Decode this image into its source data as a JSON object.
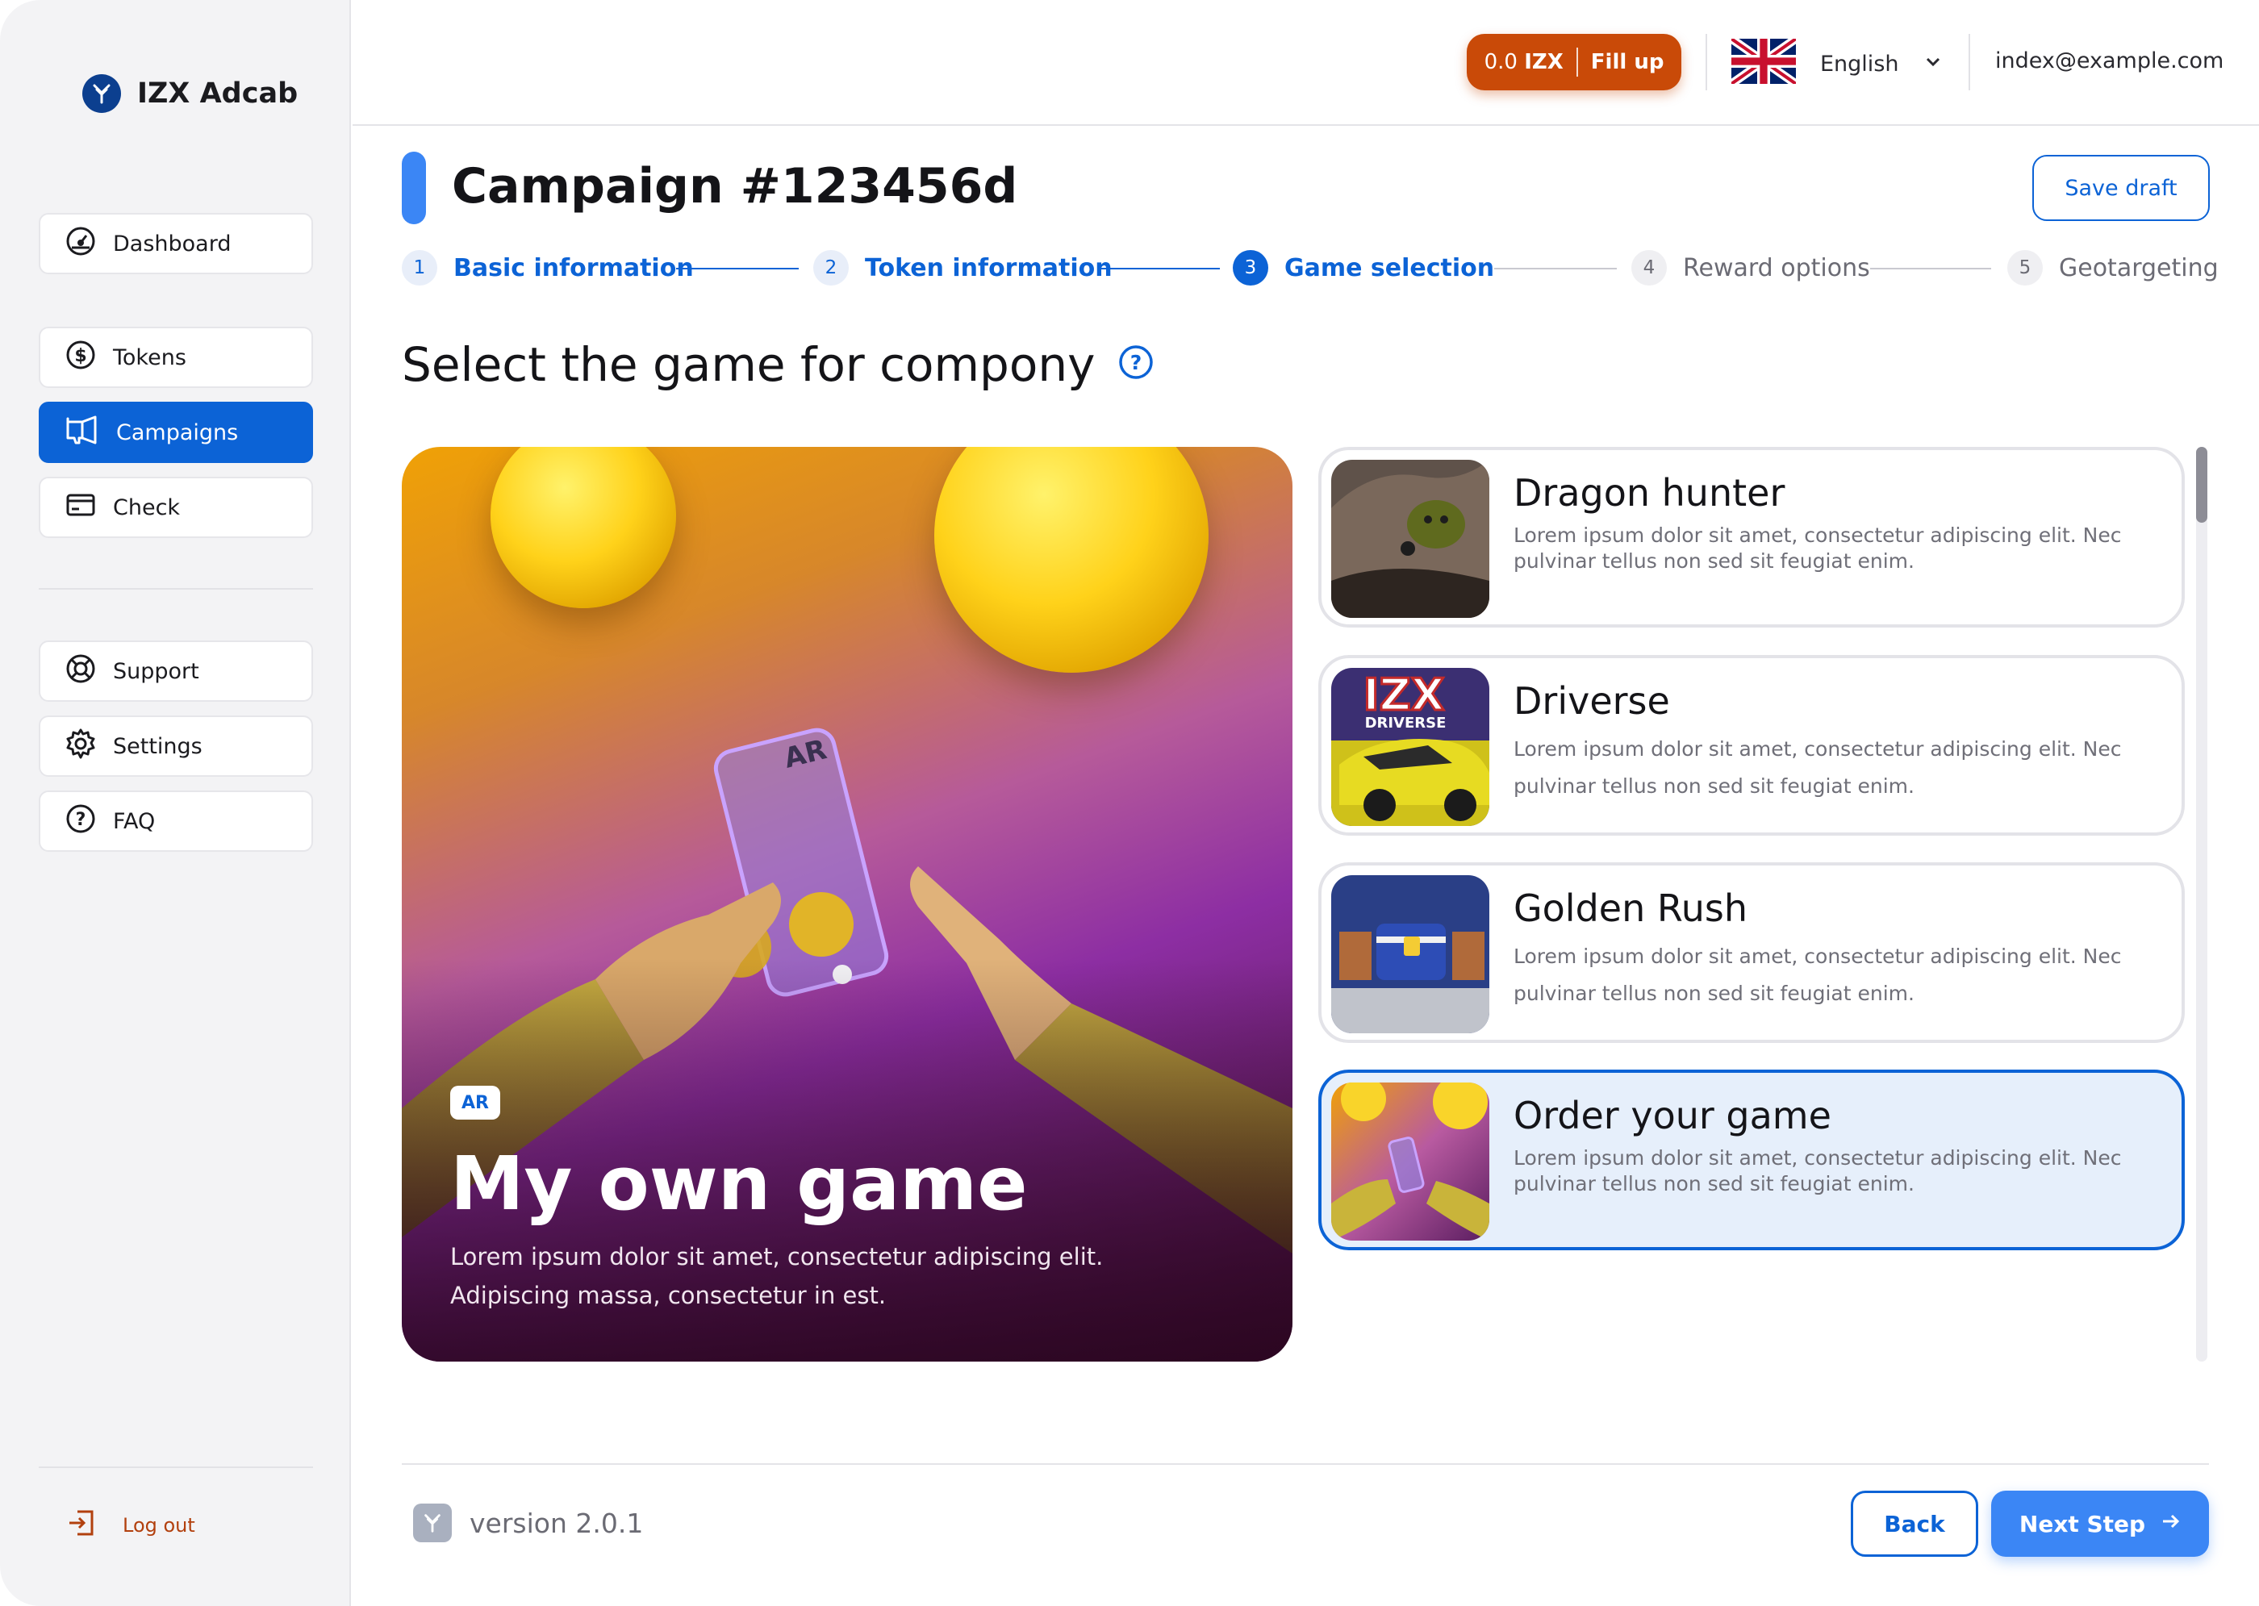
{
  "app": {
    "name": "IZX Adcab"
  },
  "sidebar": {
    "items": [
      {
        "label": "Dashboard",
        "icon": "dashboard-icon"
      },
      {
        "label": "Tokens",
        "icon": "dollar-coin-icon"
      },
      {
        "label": "Campaigns",
        "icon": "megaphone-icon",
        "active": true
      },
      {
        "label": "Check",
        "icon": "card-icon"
      },
      {
        "label": "Support",
        "icon": "lifebuoy-icon"
      },
      {
        "label": "Settings",
        "icon": "gear-icon"
      },
      {
        "label": "FAQ",
        "icon": "question-icon"
      }
    ],
    "logout_label": "Log out"
  },
  "header": {
    "balance_amount": "0.0",
    "balance_currency": "IZX",
    "fill_up_label": "Fill up",
    "language": "English",
    "email": "index@example.com"
  },
  "page": {
    "title": "Campaign #123456d",
    "save_draft_label": "Save draft",
    "steps": [
      {
        "num": "1",
        "label": "Basic information",
        "state": "done"
      },
      {
        "num": "2",
        "label": "Token information",
        "state": "done"
      },
      {
        "num": "3",
        "label": "Game selection",
        "state": "current"
      },
      {
        "num": "4",
        "label": "Reward options",
        "state": "todo"
      },
      {
        "num": "5",
        "label": "Geotargeting",
        "state": "todo"
      }
    ],
    "section_title": "Select the game for compony"
  },
  "hero": {
    "badge": "AR",
    "title": "My own game",
    "description": "Lorem ipsum dolor sit amet, consectetur adipiscing elit. Adipiscing massa, consectetur in est."
  },
  "games": [
    {
      "title": "Dragon hunter",
      "description": "Lorem ipsum dolor sit amet, consectetur adipiscing elit. Nec pulvinar tellus non sed sit feugiat enim.",
      "selected": false
    },
    {
      "title": "Driverse",
      "description": "Lorem ipsum dolor sit amet, consectetur adipiscing elit. Nec pulvinar tellus non sed sit feugiat enim.",
      "selected": false
    },
    {
      "title": "Golden Rush",
      "description": "Lorem ipsum dolor sit amet, consectetur adipiscing elit. Nec pulvinar tellus non sed sit feugiat enim.",
      "selected": false
    },
    {
      "title": "Order your game",
      "description": "Lorem ipsum dolor sit amet, consectetur adipiscing elit. Nec pulvinar tellus non sed sit feugiat enim.",
      "selected": true
    }
  ],
  "thumb_texts": {
    "driverse_logo": "IZX",
    "driverse_sub": "DRIVERSE",
    "ar_card": "AR"
  },
  "footer": {
    "version": "version 2.0.1",
    "back_label": "Back",
    "next_label": "Next Step"
  },
  "colors": {
    "primary": "#0c63d6",
    "accent_orange": "#c94a08",
    "next_button": "#3b86f5",
    "selected_card_bg": "#e6effb"
  }
}
